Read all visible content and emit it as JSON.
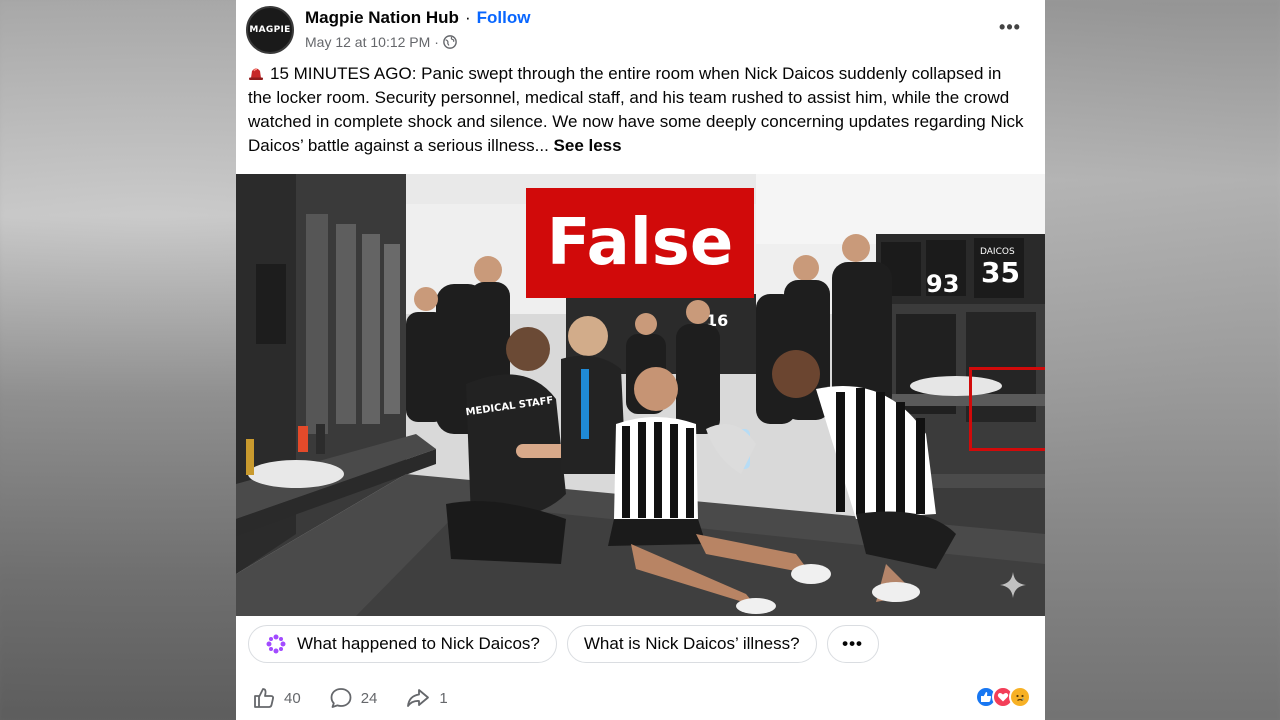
{
  "post": {
    "page_name": "Magpie Nation Hub",
    "follow_label": "Follow",
    "timestamp": "May 12 at 10:12 PM",
    "avatar_text": "MAGPIE",
    "body_text": "15 MINUTES AGO: Panic swept through the entire room when Nick Daicos suddenly collapsed in the locker room. Security personnel, medical staff, and his team rushed to assist him, while the crowd watched in complete shock and silence. We now have some deeply concerning updates regarding Nick Daicos’ battle against a serious illness...",
    "see_less_label": "See less",
    "more_label": "•••"
  },
  "photo": {
    "badge_text": "False",
    "jersey_numbers": [
      "93",
      "35",
      "16"
    ],
    "staff_shirt_text": "MEDICAL STAFF",
    "locker_label": "DAICOS"
  },
  "suggestions": {
    "items": [
      {
        "label": "What happened to Nick Daicos?"
      },
      {
        "label": "What is Nick Daicos’ illness?"
      }
    ],
    "more_label": "•••"
  },
  "actions": {
    "likes": "40",
    "comments": "24",
    "shares": "1"
  },
  "colors": {
    "accent": "#0866ff",
    "badge_red": "#d10a0a",
    "text_primary": "#050505",
    "text_secondary": "#65676b"
  }
}
